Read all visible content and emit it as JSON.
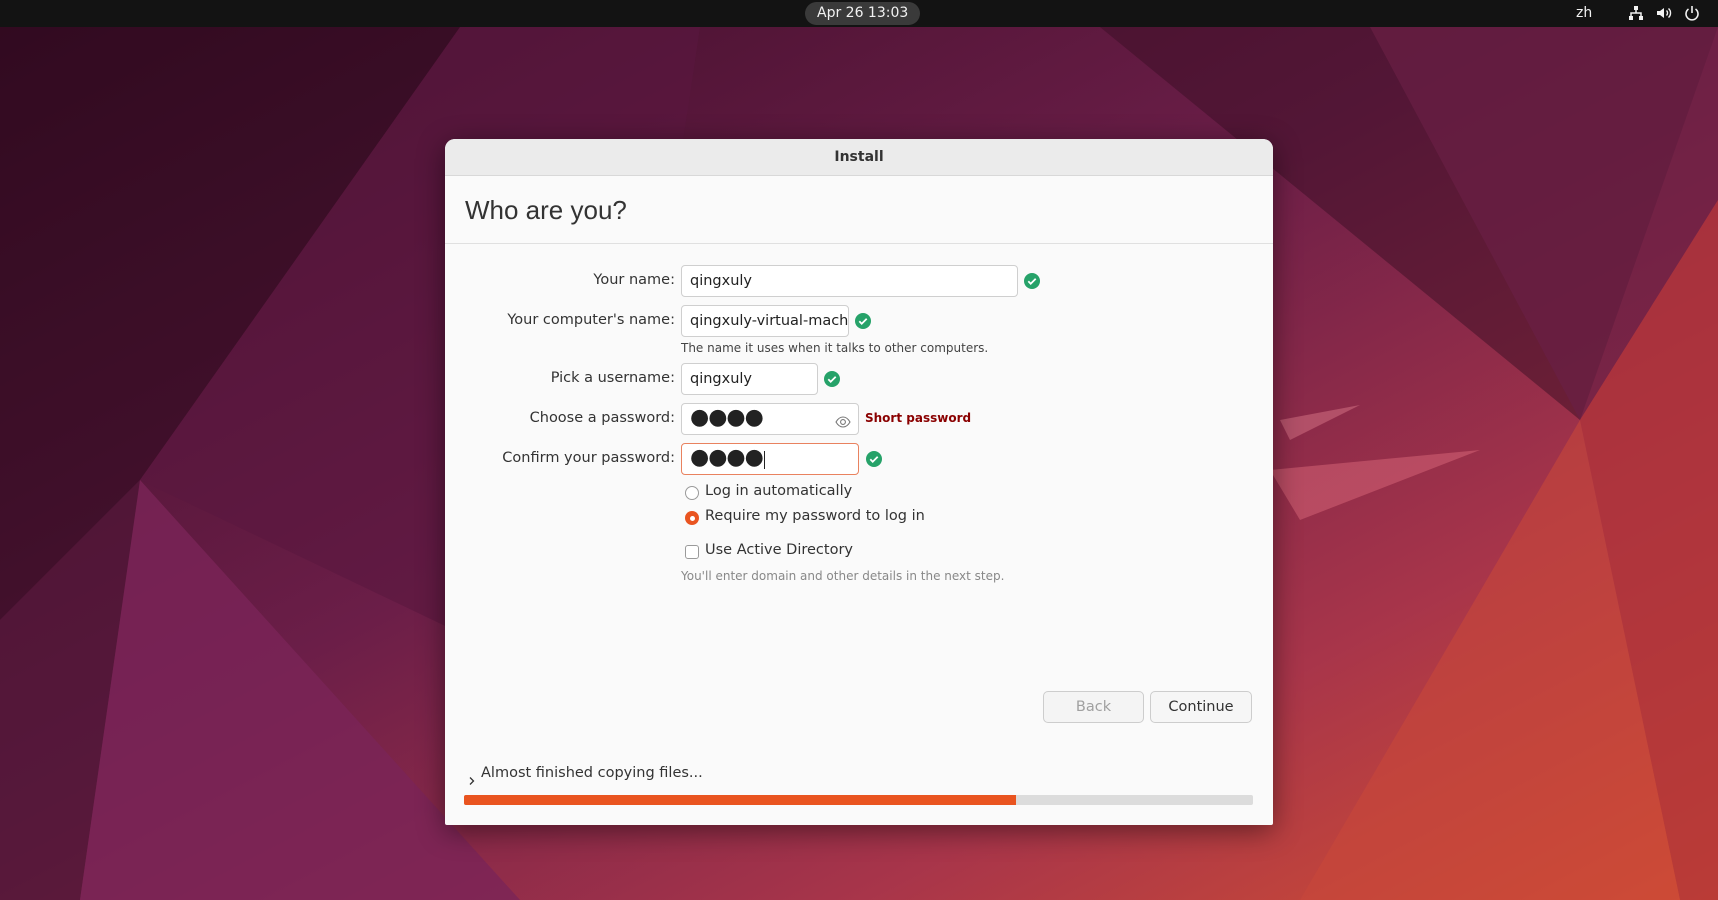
{
  "topbar": {
    "clock": "Apr 26  13:03",
    "language": "zh",
    "icons": [
      "network-icon",
      "volume-icon",
      "power-icon"
    ]
  },
  "window": {
    "title": "Install",
    "heading": "Who are you?",
    "fields": {
      "your_name": {
        "label": "Your name:",
        "value": "qingxuly",
        "valid": true
      },
      "computer_name": {
        "label": "Your computer's name:",
        "value": "qingxuly-virtual-machine",
        "valid": true,
        "hint": "The name it uses when it talks to other computers."
      },
      "username": {
        "label": "Pick a username:",
        "value": "qingxuly",
        "valid": true
      },
      "password": {
        "label": "Choose a password:",
        "value": "●●●●",
        "strength": "Short password"
      },
      "confirm_password": {
        "label": "Confirm your password:",
        "value": "●●●●",
        "valid": true
      }
    },
    "login_options": {
      "auto_login": {
        "label": "Log in automatically",
        "selected": false
      },
      "require_password": {
        "label": "Require my password to log in",
        "selected": true
      }
    },
    "active_directory": {
      "label": "Use Active Directory",
      "checked": false,
      "hint": "You'll enter domain and other details in the next step."
    },
    "buttons": {
      "back": "Back",
      "continue": "Continue"
    },
    "progress": {
      "text": "Almost finished copying files...",
      "percent": 70
    }
  },
  "colors": {
    "accent": "#e95420",
    "valid": "#26a269",
    "warning": "#8a0000",
    "topbar": "#131313"
  }
}
